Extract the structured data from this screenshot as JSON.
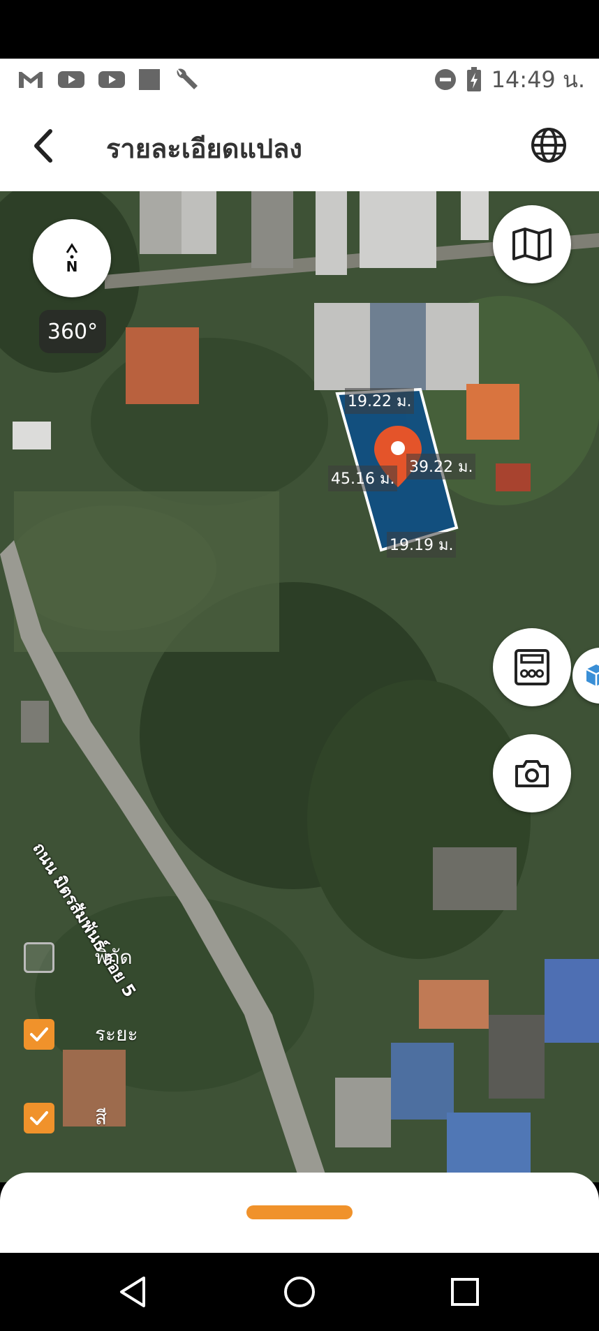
{
  "status_bar": {
    "time": "14:49 น.",
    "left_icons": [
      "gmail-icon",
      "youtube-icon",
      "youtube-icon",
      "square-icon",
      "wrench-icon"
    ],
    "right_icons": [
      "do-not-disturb-icon",
      "battery-charging-icon"
    ]
  },
  "header": {
    "title": "รายละเอียดแปลง",
    "back_icon": "chevron-left-icon",
    "globe_icon": "globe-icon"
  },
  "map": {
    "compass_label": "N",
    "degree_label": "360°",
    "parcel_dimensions": {
      "top": "19.22 ม.",
      "right": "39.22 ม.",
      "left": "45.16 ม.",
      "bottom": "19.19 ม."
    },
    "road_name": "ถนน มิตรสัมพันธ์ ซอย 5",
    "parcel_fill_color": "#0d4f86",
    "pin_color": "#e4542a"
  },
  "layers": [
    {
      "label": "พิกัด",
      "checked": false
    },
    {
      "label": "ระยะ",
      "checked": true
    },
    {
      "label": "สี",
      "checked": true
    }
  ],
  "accent_color": "#f0922b",
  "nav_bar": {
    "icons": [
      "back-triangle-icon",
      "home-circle-icon",
      "recents-square-icon"
    ]
  }
}
